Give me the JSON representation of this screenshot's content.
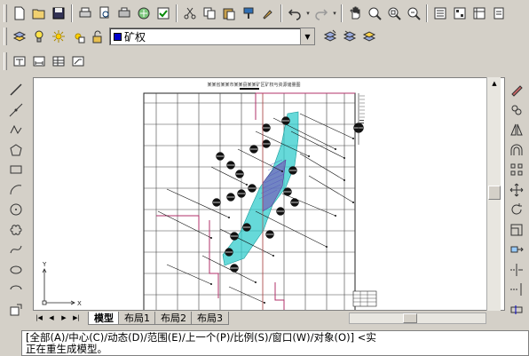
{
  "toolbar_standard": {
    "icons": [
      "new-icon",
      "open-icon",
      "save-icon",
      "print-icon",
      "print-preview-icon",
      "plot-icon",
      "publish-icon",
      "check-icon",
      "cut-icon",
      "copy-icon",
      "paste-icon",
      "match-properties-icon",
      "brush-icon",
      "undo-icon",
      "redo-icon",
      "pan-icon",
      "zoom-realtime-icon",
      "zoom-window-icon",
      "zoom-previous-icon",
      "properties-icon",
      "design-center-icon",
      "tool-palettes-icon",
      "sheet-set-icon"
    ]
  },
  "layer_toolbar": {
    "current_layer": "矿权",
    "layer_color": "#0000cc"
  },
  "tab_bar": {
    "tabs": [
      "模型",
      "布局1",
      "布局2",
      "布局3"
    ],
    "active_tab": "模型"
  },
  "drawing": {
    "title_text": "某某省某某市某某县某某矿区矿权与资源储量图",
    "axis_y": "Y",
    "axis_x": "X"
  },
  "command_line": {
    "line1": "[全部(A)/中心(C)/动态(D)/范围(E)/上一个(P)/比例(S)/窗口(W)/对象(O)] <实",
    "line2": "正在重生成模型。"
  },
  "colors": {
    "accent_cyan": "#33cccc",
    "accent_magenta": "#cc3399",
    "layer_blue": "#0000cc"
  }
}
